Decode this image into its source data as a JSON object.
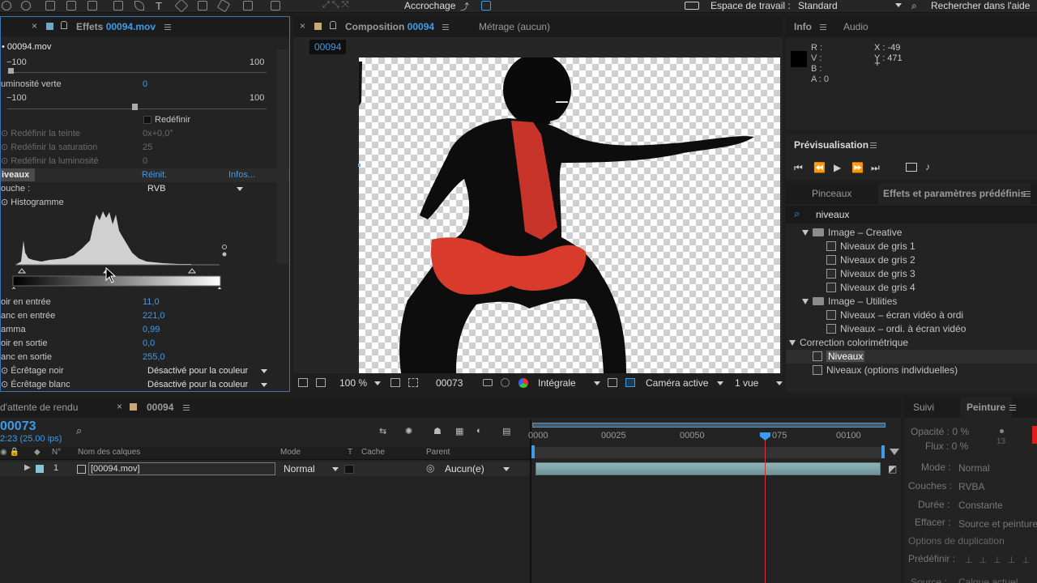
{
  "toolbar": {
    "accrochage": "Accrochage",
    "workspace_label": "Espace de travail :",
    "workspace_value": "Standard",
    "search_label": "Rechercher dans l'aide"
  },
  "effects_panel": {
    "tab_prefix": "Effets",
    "tab_file": "00094.mov",
    "file_label": "• 00094.mov",
    "slider1": {
      "min": "−100",
      "max": "100"
    },
    "lum_verte_label": "uminosité verte",
    "lum_verte_value": "0",
    "slider2": {
      "min": "−100",
      "max": "100"
    },
    "redefinir": "Redéfinir",
    "teinte_label": "Redéfinir la teinte",
    "teinte_value": "0x+0,0°",
    "saturation_label": "Redéfinir la saturation",
    "saturation_value": "25",
    "luminosite_label": "Redéfinir la luminosité",
    "luminosite_value": "0",
    "niveaux_label": "iveaux",
    "reinit": "Réinit.",
    "infos": "Infos...",
    "couche_label": "ouche :",
    "couche_value": "RVB",
    "histogramme": "Histogramme",
    "params": [
      {
        "label": "oir en entrée",
        "value": "11,0"
      },
      {
        "label": "anc en entrée",
        "value": "221,0"
      },
      {
        "label": "amma",
        "value": "0,99"
      },
      {
        "label": "oir en sortie",
        "value": "0,0"
      },
      {
        "label": "anc en sortie",
        "value": "255,0"
      }
    ],
    "ecretage_noir_label": "Écrêtage noir",
    "ecretage_noir_value": "Désactivé pour la couleur",
    "ecretage_blanc_label": "Écrêtage blanc",
    "ecretage_blanc_value": "Désactivé pour la couleur"
  },
  "composition": {
    "tab_label": "Composition",
    "tab_name": "00094",
    "metrage": "Métrage (aucun)",
    "comp_chip": "00094",
    "zoom": "100 %",
    "timecode": "00073",
    "resolution": "Intégrale",
    "camera": "Caméra active",
    "views": "1 vue"
  },
  "info": {
    "tab_info": "Info",
    "tab_audio": "Audio",
    "r": "R :",
    "v": "V :",
    "b": "B :",
    "a": "A : 0",
    "x": "X : -49",
    "y": "Y : 471"
  },
  "preview": {
    "title": "Prévisualisation"
  },
  "effects_presets": {
    "tab_pinceaux": "Pinceaux",
    "tab_effets": "Effets et paramètres prédéfinis",
    "search_value": "niveaux",
    "tree": [
      {
        "label": "Image – Creative",
        "kind": "folder",
        "level": 1
      },
      {
        "label": "Niveaux de gris 1",
        "kind": "preset",
        "level": 2
      },
      {
        "label": "Niveaux de gris 2",
        "kind": "preset",
        "level": 2
      },
      {
        "label": "Niveaux de gris 3",
        "kind": "preset",
        "level": 2
      },
      {
        "label": "Niveaux de gris 4",
        "kind": "preset",
        "level": 2
      },
      {
        "label": "Image – Utilities",
        "kind": "folder",
        "level": 1
      },
      {
        "label": "Niveaux – écran vidéo à ordi",
        "kind": "preset",
        "level": 2
      },
      {
        "label": "Niveaux – ordi. à écran vidéo",
        "kind": "preset",
        "level": 2
      },
      {
        "label": "Correction colorimétrique",
        "kind": "category",
        "level": 0
      },
      {
        "label": "Niveaux",
        "kind": "effect",
        "level": 1,
        "selected": true
      },
      {
        "label": "Niveaux (options individuelles)",
        "kind": "effect",
        "level": 1
      }
    ]
  },
  "timeline": {
    "render_queue_tab": "d'attente de rendu",
    "comp_tab": "00094",
    "timecode": "00073",
    "fps": "2:23 (25.00 ips)",
    "columns": {
      "num": "N°",
      "layer_name": "Nom des calques",
      "mode": "Mode",
      "t": "T",
      "cache": "Cache",
      "parent": "Parent"
    },
    "ruler": [
      "0000",
      "00025",
      "00050",
      "075",
      "00100"
    ],
    "layer": {
      "index": "1",
      "name": "[00094.mov]",
      "mode": "Normal",
      "parent": "Aucun(e)"
    }
  },
  "paint_panel": {
    "tab_suivi": "Suivi",
    "tab_peinture": "Peinture",
    "opacite": "Opacité : 0 %",
    "flux": "Flux : 0 %",
    "size": "13",
    "mode_label": "Mode :",
    "mode_value": "Normal",
    "couches_label": "Couches :",
    "couches_value": "RVBA",
    "duree_label": "Durée :",
    "duree_value": "Constante",
    "effacer_label": "Effacer :",
    "effacer_value": "Source et peinture",
    "options_duplication": "Options de duplication",
    "predefinir": "Prédéfinir :",
    "source_label": "Source :",
    "source_value": "Calque actuel"
  },
  "colors": {
    "accent": "#3d9be9",
    "panel_focus": "#3b76b0",
    "playhead": "#d03535"
  }
}
